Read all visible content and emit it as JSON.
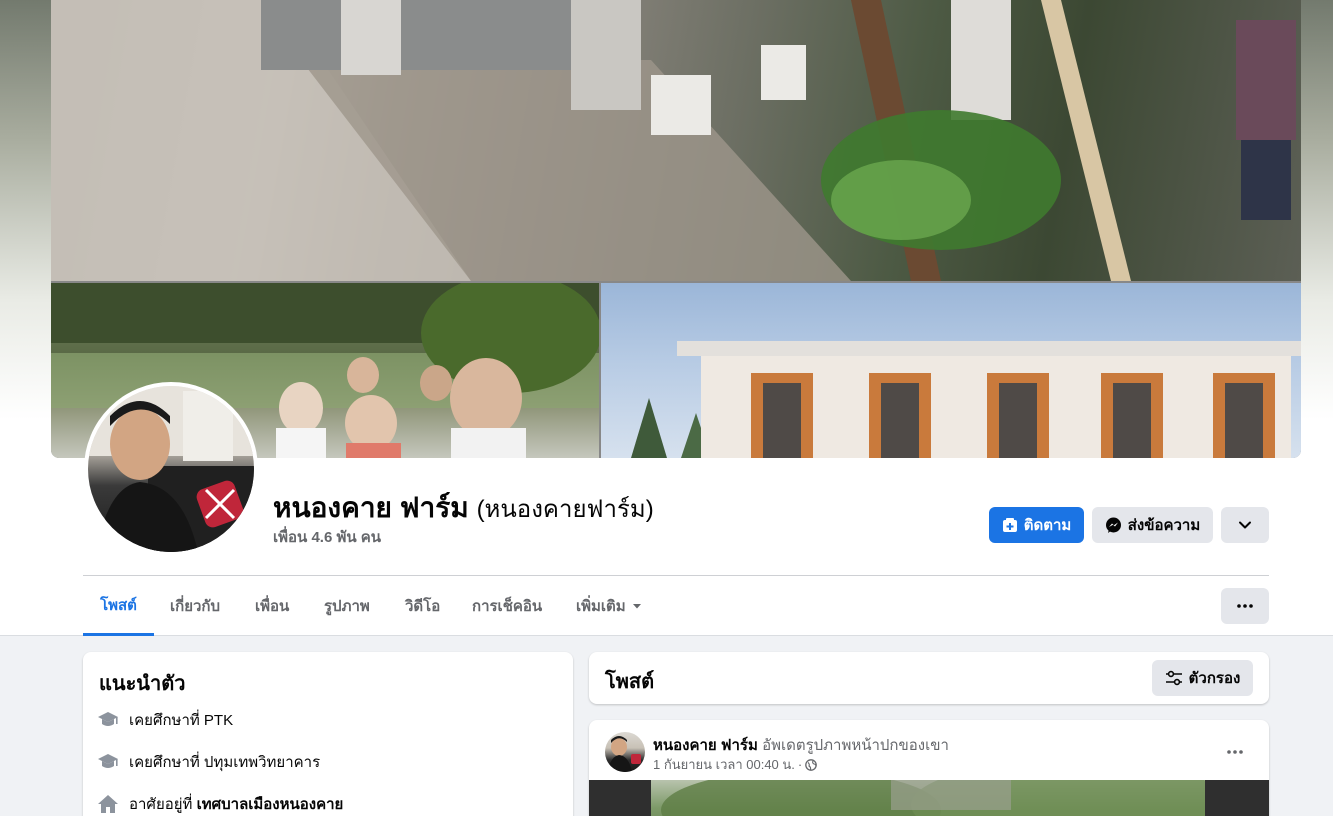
{
  "profile": {
    "name": "หนองคาย ฟาร์ม",
    "alternate_name": "(หนองคายฟาร์ม)",
    "friends": "เพื่อน 4.6 พัน คน"
  },
  "actions": {
    "follow_label": "ติดตาม",
    "message_label": "ส่งข้อความ"
  },
  "tabs": [
    {
      "label": "โพสต์",
      "active": true
    },
    {
      "label": "เกี่ยวกับ",
      "active": false
    },
    {
      "label": "เพื่อน",
      "active": false
    },
    {
      "label": "รูปภาพ",
      "active": false
    },
    {
      "label": "วิดีโอ",
      "active": false
    },
    {
      "label": "การเช็คอิน",
      "active": false
    },
    {
      "label": "เพิ่มเติม",
      "active": false
    }
  ],
  "intro": {
    "title": "แนะนำตัว",
    "items": [
      {
        "icon": "graduation-cap-icon",
        "prefix": "เคยศึกษาที่ ",
        "value": "PTK",
        "bold": false
      },
      {
        "icon": "graduation-cap-icon",
        "prefix": "เคยศึกษาที่ ",
        "value": "ปทุมเทพวิทยาคาร",
        "bold": false
      },
      {
        "icon": "home-icon",
        "prefix": "อาศัยอยู่ที่ ",
        "value": "เทศบาลเมืองหนองคาย",
        "bold": true
      }
    ]
  },
  "posts": {
    "title": "โพสต์",
    "filter_label": "ตัวกรอง",
    "items": [
      {
        "author": "หนองคาย ฟาร์ม",
        "action": "อัพเดตรูปภาพหน้าปกของเขา",
        "timestamp": "1 กันยายน เวลา 00:40 น.",
        "separator": "·",
        "audience_icon": "globe-icon"
      }
    ]
  },
  "colors": {
    "accent": "#1b74e4",
    "secondary_button": "#e4e6eb",
    "page_background": "#f0f2f5",
    "muted_text": "#65676b"
  }
}
